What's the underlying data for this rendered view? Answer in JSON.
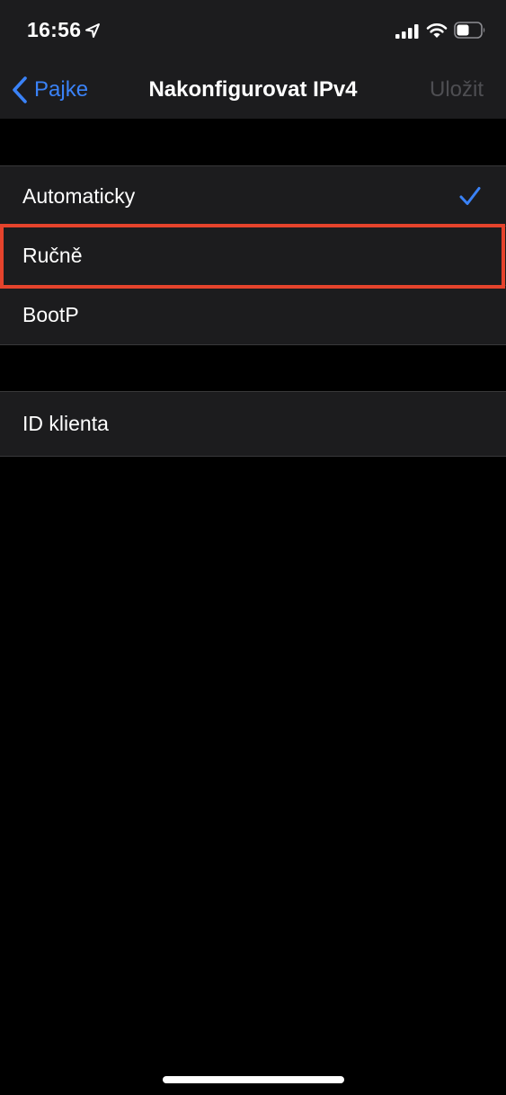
{
  "status_bar": {
    "time": "16:56",
    "icons": [
      "location-arrow-icon",
      "cellular-signal-icon",
      "wifi-icon",
      "battery-icon"
    ]
  },
  "nav": {
    "back_label": "Pajke",
    "title": "Nakonfigurovat IPv4",
    "save_label": "Uložit"
  },
  "config_options": [
    {
      "label": "Automaticky",
      "selected": true
    },
    {
      "label": "Ručně",
      "selected": false,
      "highlighted": true
    },
    {
      "label": "BootP",
      "selected": false
    }
  ],
  "client_section": {
    "label": "ID klienta"
  },
  "colors": {
    "background": "#000000",
    "cell_background": "#1c1c1e",
    "accent": "#3a82f7",
    "highlight_box": "#e5432c",
    "disabled_text": "#4e4e52"
  }
}
